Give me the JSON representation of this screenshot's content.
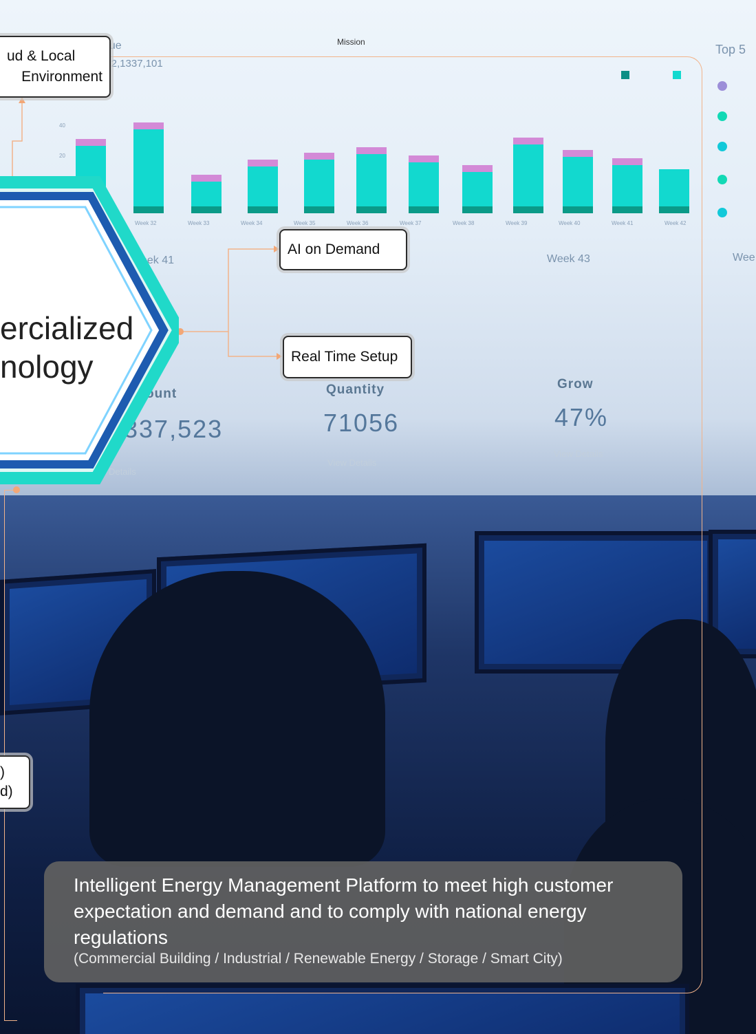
{
  "mission_label": "Mission",
  "dashboard": {
    "revenue_title": "nue",
    "revenue_total": "l: 2,1337,101",
    "legend": {
      "previous_color": "#0b8f86",
      "current_color": "#12d9cf"
    },
    "y_ticks": [
      "40",
      "20"
    ],
    "weeks": [
      "Week 32",
      "Week 33",
      "Week 34",
      "Week 35",
      "Week 36",
      "Week 37",
      "Week 38",
      "Week 39",
      "Week 40",
      "Week 41",
      "Week 42"
    ],
    "week_labels": [
      "eek 41",
      "Week 43",
      "Wee"
    ],
    "top5_title": "Top 5",
    "kpi_amount_label": "ount",
    "kpi_amount_value": "337,523",
    "kpi_amount_link": "w Details",
    "kpi_quantity_label": "Quantity",
    "kpi_quantity_value": "71056",
    "kpi_quantity_link": "View Details",
    "kpi_grow_label": "Grow",
    "kpi_grow_value": "47%",
    "kpi_grow_link": "View Details"
  },
  "callouts": {
    "cloud_line1": "ud & Local",
    "cloud_line2": "Environment",
    "ai_on_demand": "AI on Demand",
    "real_time_setup": "Real Time Setup",
    "left_line1": ")",
    "left_line2": "d)"
  },
  "hexagon": {
    "line1": "ercialized",
    "line2": "nology"
  },
  "caption": {
    "main": "Intelligent Energy Management Platform to meet high customer expectation and demand and to comply with national energy regulations",
    "sub": "(Commercial Building / Industrial / Renewable Energy / Storage / Smart City)"
  },
  "colors": {
    "accent_orange": "#f2a777",
    "hex_blue": "#1d5bb0",
    "hex_teal": "#20d9c9"
  }
}
